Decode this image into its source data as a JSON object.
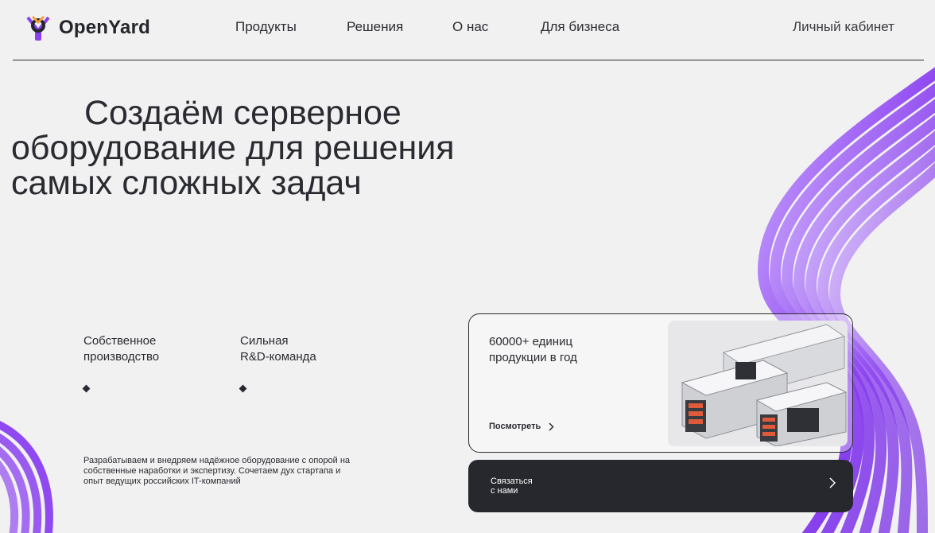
{
  "header": {
    "logo_text": "OpenYard",
    "nav": [
      "Продукты",
      "Решения",
      "О нас",
      "Для бизнеса"
    ],
    "account": "Личный кабинет"
  },
  "hero": {
    "headline": [
      "Создаём серверное",
      "оборудование для решения",
      "самых сложных задач"
    ]
  },
  "features": [
    {
      "lines": [
        "Собственное",
        "производство"
      ]
    },
    {
      "lines": [
        "Сильная",
        "R&D-команда"
      ]
    }
  ],
  "description": "Разрабатываем и внедряем надёжное оборудование с опорой на собственные наработки и экспертизу. Сочетаем дух стартапа и опыт ведущих российских IT-компаний",
  "product_card": {
    "stat_lines": [
      "60000+ единиц",
      "продукции в год"
    ],
    "link": "Посмотреть",
    "image_icon": "server-rack-icon"
  },
  "contact": {
    "lines": [
      "Связаться",
      "с нами"
    ],
    "chevron_icon": "chevron-right-icon"
  },
  "colors": {
    "background": "#f1f1f1",
    "text": "#2a2b31",
    "accent_purple": "#8a3ff0",
    "button_dark": "#27282d"
  }
}
